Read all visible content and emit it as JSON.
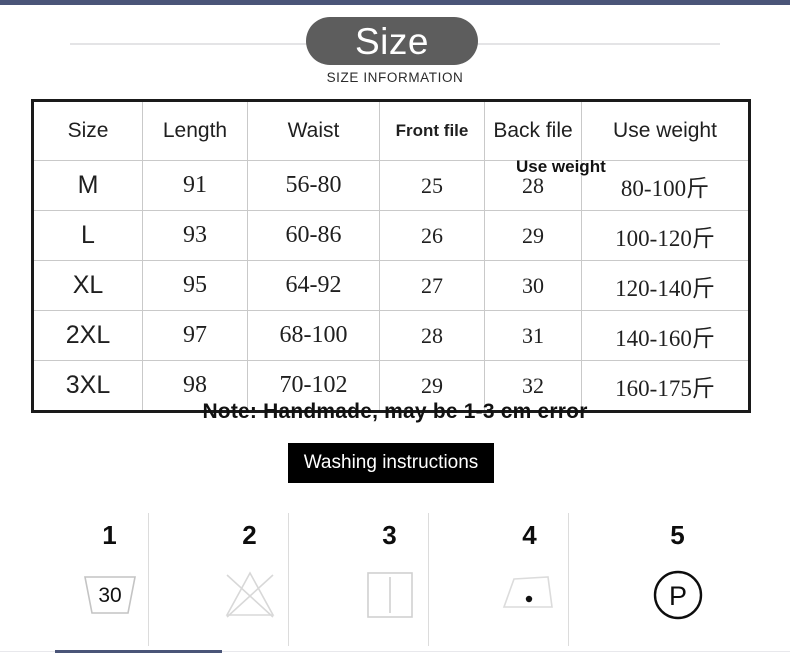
{
  "header": {
    "title": "Size",
    "subtitle": "SIZE INFORMATION"
  },
  "table": {
    "columns": [
      "Size",
      "Length",
      "Waist",
      "Front file",
      "Back file",
      "Use weight"
    ],
    "rows": [
      {
        "size": "M",
        "length": "91",
        "waist": "56-80",
        "front": "25",
        "back": "28",
        "weight": "80-100斤"
      },
      {
        "size": "L",
        "length": "93",
        "waist": "60-86",
        "front": "26",
        "back": "29",
        "weight": "100-120斤"
      },
      {
        "size": "XL",
        "length": "95",
        "waist": "64-92",
        "front": "27",
        "back": "30",
        "weight": "120-140斤"
      },
      {
        "size": "2XL",
        "length": "97",
        "waist": "68-100",
        "front": "28",
        "back": "31",
        "weight": "140-160斤"
      },
      {
        "size": "3XL",
        "length": "98",
        "waist": "70-102",
        "front": "29",
        "back": "32",
        "weight": "160-175斤"
      }
    ],
    "stray_overlap_label": "Use weight"
  },
  "note": "Note: Handmade, may be 1-3 cm error",
  "wash_banner": "Washing instructions",
  "care_symbols": [
    {
      "number": "1",
      "icon": "wash-tub-30-icon",
      "temperature": "30"
    },
    {
      "number": "2",
      "icon": "do-not-bleach-icon",
      "temperature": ""
    },
    {
      "number": "3",
      "icon": "drip-dry-square-icon",
      "temperature": ""
    },
    {
      "number": "4",
      "icon": "iron-low-heat-icon",
      "temperature": ""
    },
    {
      "number": "5",
      "icon": "dry-clean-p-icon",
      "temperature": "P"
    }
  ],
  "colors": {
    "accent_bar": "#4a5578",
    "title_pill": "#5d5d5d",
    "banner": "#000000",
    "table_border": "#1a1a1a"
  }
}
